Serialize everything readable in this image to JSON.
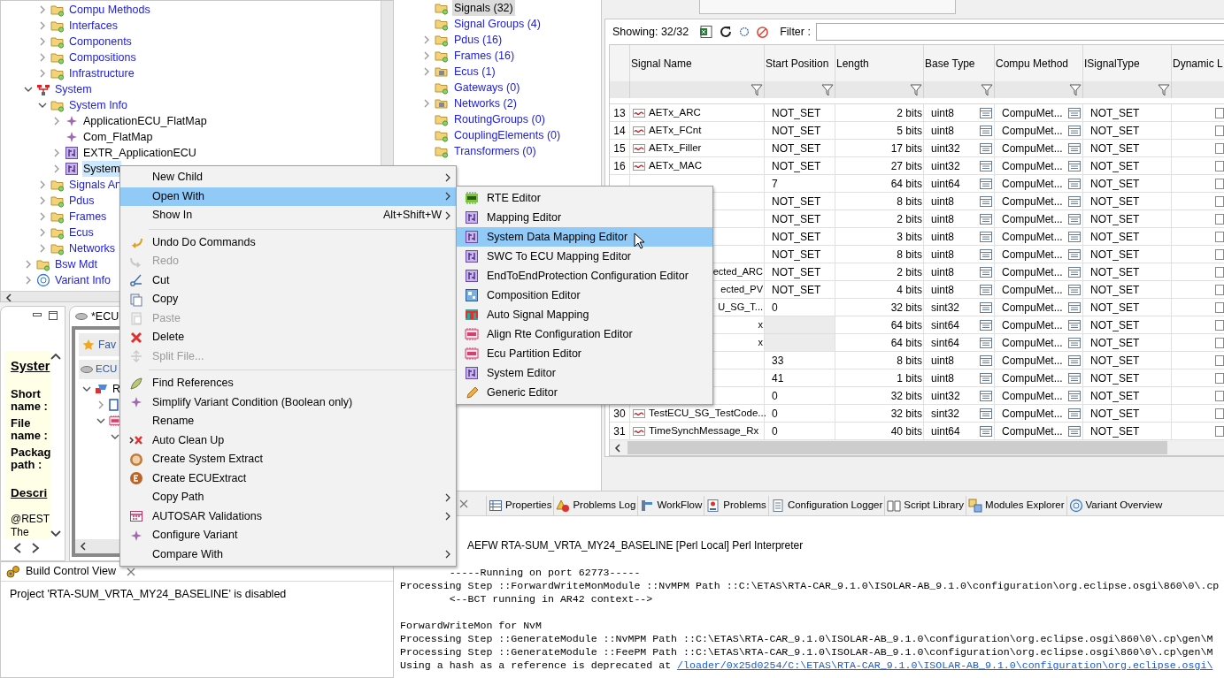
{
  "project_tree": {
    "items": [
      {
        "children": [
          {
            "label": "Compu Methods",
            "kind": "folder",
            "expanded": false
          },
          {
            "label": "Interfaces",
            "kind": "folder",
            "expanded": false
          },
          {
            "label": "Components",
            "kind": "folder",
            "expanded": false
          },
          {
            "label": "Compositions",
            "kind": "folder",
            "expanded": false
          },
          {
            "label": "Infrastructure",
            "kind": "folder",
            "expanded": false
          }
        ]
      },
      {
        "label": "System",
        "kind": "system",
        "expanded": true,
        "children": [
          {
            "label": "System Info",
            "kind": "folder",
            "expanded": true,
            "children": [
              {
                "label": "ApplicationECU_FlatMap",
                "kind": "diamond",
                "expanded": false
              },
              {
                "label": "Com_FlatMap",
                "kind": "diamond"
              },
              {
                "label": "EXTR_ApplicationECU",
                "kind": "component",
                "expanded": false
              },
              {
                "label": "System",
                "kind": "component",
                "expanded": false,
                "selected": true
              }
            ]
          },
          {
            "label": "Signals An",
            "kind": "folder",
            "expanded": false
          },
          {
            "label": "Pdus",
            "kind": "folder",
            "expanded": false
          },
          {
            "label": "Frames",
            "kind": "folder",
            "expanded": false
          },
          {
            "label": "Ecus",
            "kind": "folder",
            "expanded": false
          },
          {
            "label": "Networks",
            "kind": "folder",
            "expanded": false
          }
        ]
      },
      {
        "label": "Bsw Mdt",
        "kind": "folder",
        "expanded": false
      },
      {
        "label": "Variant Info",
        "kind": "variant",
        "expanded": false
      }
    ]
  },
  "element_tree": {
    "items": [
      {
        "label": "Signals (32)",
        "kind": "folder",
        "selected": true
      },
      {
        "label": "Signal Groups (4)",
        "kind": "folder",
        "selected": false
      },
      {
        "label": "Pdus (16)",
        "kind": "folder",
        "expanded": false,
        "selected": false
      },
      {
        "label": "Frames (16)",
        "kind": "folder",
        "expanded": false,
        "selected": false
      },
      {
        "label": "Ecus (1)",
        "kind": "chip_folder",
        "expanded": false,
        "selected": false
      },
      {
        "label": "Gateways (0)",
        "kind": "folder",
        "selected": false
      },
      {
        "label": "Networks (2)",
        "kind": "chip_folder",
        "expanded": false,
        "selected": false
      },
      {
        "label": "RoutingGroups (0)",
        "kind": "folder",
        "selected": false
      },
      {
        "label": "CouplingElements (0)",
        "kind": "folder",
        "selected": false
      },
      {
        "label": "Transformers (0)",
        "kind": "folder",
        "selected": false
      }
    ]
  },
  "signal_table": {
    "showing": "Showing: 32/32",
    "filter_label": "Filter :",
    "columns": [
      "Signal Name",
      "Start Position",
      "Length",
      "Base Type",
      "Compu Method",
      "ISignalType",
      "Dynamic L"
    ],
    "rows": [
      {
        "num": "13",
        "name": "AETx_ARC",
        "start": "NOT_SET",
        "length": "2 bits",
        "base_type": "uint8",
        "compu_method": "CompuMet...",
        "isignal_type": "NOT_SET",
        "dynamic_length": false
      },
      {
        "num": "14",
        "name": "AETx_FCnt",
        "start": "NOT_SET",
        "length": "5 bits",
        "base_type": "uint8",
        "compu_method": "CompuMet...",
        "isignal_type": "NOT_SET",
        "dynamic_length": false
      },
      {
        "num": "15",
        "name": "AETx_Filler",
        "start": "NOT_SET",
        "length": "17 bits",
        "base_type": "uint32",
        "compu_method": "CompuMet...",
        "isignal_type": "NOT_SET",
        "dynamic_length": false
      },
      {
        "num": "16",
        "name": "AETx_MAC",
        "start": "NOT_SET",
        "length": "27 bits",
        "base_type": "uint32",
        "compu_method": "CompuMet...",
        "isignal_type": "NOT_SET",
        "dynamic_length": false
      },
      {
        "start": "7",
        "length": "64 bits",
        "base_type": "uint64",
        "compu_method": "CompuMet...",
        "isignal_type": "NOT_SET",
        "dynamic_length": false
      },
      {
        "start": "NOT_SET",
        "length": "8 bits",
        "base_type": "uint8",
        "compu_method": "CompuMet...",
        "isignal_type": "NOT_SET",
        "dynamic_length": false
      },
      {
        "start": "NOT_SET",
        "length": "2 bits",
        "base_type": "uint8",
        "compu_method": "CompuMet...",
        "isignal_type": "NOT_SET",
        "dynamic_length": false
      },
      {
        "start": "NOT_SET",
        "length": "3 bits",
        "base_type": "uint8",
        "compu_method": "CompuMet...",
        "isignal_type": "NOT_SET",
        "dynamic_length": false
      },
      {
        "start": "NOT_SET",
        "length": "8 bits",
        "base_type": "uint8",
        "compu_method": "CompuMet...",
        "isignal_type": "NOT_SET",
        "dynamic_length": false
      },
      {
        "name": "ected_ARC",
        "start": "NOT_SET",
        "length": "2 bits",
        "base_type": "uint8",
        "compu_method": "CompuMet...",
        "isignal_type": "NOT_SET",
        "dynamic_length": false
      },
      {
        "name": "ected_PV",
        "start": "NOT_SET",
        "length": "4 bits",
        "base_type": "uint8",
        "compu_method": "CompuMet...",
        "isignal_type": "NOT_SET",
        "dynamic_length": false
      },
      {
        "name": "U_SG_T...",
        "start": "0",
        "length": "32 bits",
        "base_type": "sint32",
        "compu_method": "CompuMet...",
        "isignal_type": "NOT_SET",
        "dynamic_length": false
      },
      {
        "name": "x",
        "start_disabled": true,
        "length": "64 bits",
        "base_type": "sint64",
        "compu_method": "CompuMet...",
        "isignal_type": "NOT_SET",
        "dynamic_length": false
      },
      {
        "name": "x",
        "start_disabled": true,
        "length": "64 bits",
        "base_type": "sint64",
        "compu_method": "CompuMet...",
        "isignal_type": "NOT_SET",
        "dynamic_length": false
      },
      {
        "start": "33",
        "length": "8 bits",
        "base_type": "uint8",
        "compu_method": "CompuMet...",
        "isignal_type": "NOT_SET",
        "dynamic_length": false
      },
      {
        "start": "41",
        "length": "1 bits",
        "base_type": "uint8",
        "compu_method": "CompuMet...",
        "isignal_type": "NOT_SET",
        "dynamic_length": false
      },
      {
        "start": "0",
        "length": "32 bits",
        "base_type": "uint32",
        "compu_method": "CompuMet...",
        "isignal_type": "NOT_SET",
        "dynamic_length": false
      },
      {
        "num": "30",
        "name": "TestECU_SG_TestCode...",
        "start": "0",
        "length": "32 bits",
        "base_type": "sint32",
        "compu_method": "CompuMet...",
        "isignal_type": "NOT_SET",
        "dynamic_length": false
      },
      {
        "num": "31",
        "name": "TimeSynchMessage_Rx",
        "start": "0",
        "length": "40 bits",
        "base_type": "uint64",
        "compu_method": "CompuMet...",
        "isignal_type": "NOT_SET",
        "dynamic_length": false
      }
    ]
  },
  "description_panel": {
    "heading": "Syster",
    "fields": [
      "Short name :",
      "File name :",
      "Packag path :"
    ],
    "section": "Descri",
    "text_lines": [
      "@REST",
      "The"
    ]
  },
  "ecu_editor": {
    "tab": "*ECU",
    "favorites": "Fav",
    "ecu": "ECU",
    "node": "R"
  },
  "build_control": {
    "title": "Build Control View",
    "message": "Project 'RTA-SUM_VRTA_MY24_BASELINE' is disabled"
  },
  "bottom_tabs": [
    {
      "label": "Properties",
      "kind": "table"
    },
    {
      "label": "Problems Log",
      "kind": "warning"
    },
    {
      "label": "WorkFlow",
      "kind": "flow"
    },
    {
      "label": "Problems",
      "kind": "problems"
    },
    {
      "label": "Configuration Logger",
      "kind": "log"
    },
    {
      "label": "Script Library",
      "kind": "book"
    },
    {
      "label": "Modules Explorer",
      "kind": "modules"
    },
    {
      "label": "Variant Overview",
      "kind": "variant"
    }
  ],
  "console": {
    "title": "AEFW RTA-SUM_VRTA_MY24_BASELINE [Perl Local] Perl Interpreter",
    "lines": [
      {
        "text": "        -----Running on port 62773-----"
      },
      {
        "text": "Processing Step ::ForwardWriteMonModule ::NvMPM Path ::C:\\ETAS\\RTA-CAR_9.1.0\\ISOLAR-AB_9.1.0\\configuration\\org.eclipse.osgi\\860\\0\\.cp"
      },
      {
        "text": "        <--BCT running in AR42 context-->"
      },
      {
        "text": "ForwardWriteMon for NvM",
        "gap_before": true
      },
      {
        "text": "Processing Step ::GenerateModule ::NvMPM Path ::C:\\ETAS\\RTA-CAR_9.1.0\\ISOLAR-AB_9.1.0\\configuration\\org.eclipse.osgi\\860\\0\\.cp\\gen\\M"
      },
      {
        "text": "Processing Step ::GenerateModule ::FeePM Path ::C:\\ETAS\\RTA-CAR_9.1.0\\ISOLAR-AB_9.1.0\\configuration\\org.eclipse.osgi\\860\\0\\.cp\\gen\\M"
      },
      {
        "text": "Using a hash as a reference is deprecated at ",
        "link": "/loader/0x25d0254/C:\\ETAS\\RTA-CAR_9.1.0\\ISOLAR-AB_9.1.0\\configuration\\org.eclipse.osgi\\"
      }
    ]
  },
  "context_menu": {
    "items": [
      {
        "label": "New Child",
        "submenu": true
      },
      {
        "label": "Open With",
        "submenu": true,
        "selected": true
      },
      {
        "label": "Show In",
        "shortcut": "Alt+Shift+W",
        "submenu": true
      },
      {
        "label": "Undo Do Commands",
        "kind": "undo",
        "separator_before": true
      },
      {
        "label": "Redo",
        "kind": "redo",
        "disabled": true
      },
      {
        "label": "Cut",
        "kind": "cut"
      },
      {
        "label": "Copy",
        "kind": "copy"
      },
      {
        "label": "Paste",
        "kind": "paste",
        "disabled": true
      },
      {
        "label": "Delete",
        "kind": "delete"
      },
      {
        "label": "Split File...",
        "kind": "split",
        "disabled": true
      },
      {
        "label": "Find References",
        "kind": "find",
        "separator_before": true
      },
      {
        "label": "Simplify Variant Condition (Boolean only)",
        "kind": "diamond"
      },
      {
        "label": "Rename"
      },
      {
        "label": "Auto Clean Up",
        "kind": "clean"
      },
      {
        "label": "Create System Extract",
        "kind": "s_badge"
      },
      {
        "label": "Create ECUExtract",
        "kind": "e_badge"
      },
      {
        "label": "Copy Path",
        "submenu": true
      },
      {
        "label": "AUTOSAR Validations",
        "kind": "validation",
        "submenu": true
      },
      {
        "label": "Configure Variant",
        "kind": "diamond"
      },
      {
        "label": "Compare With",
        "submenu": true
      }
    ]
  },
  "open_with_menu": {
    "items": [
      {
        "label": "RTE Editor",
        "kind": "rte",
        "selected": false
      },
      {
        "label": "Mapping Editor",
        "kind": "component",
        "selected": false
      },
      {
        "label": "System Data Mapping Editor",
        "kind": "component",
        "selected": true
      },
      {
        "label": "SWC To ECU Mapping Editor",
        "kind": "component",
        "selected": false
      },
      {
        "label": "EndToEndProtection Configuration Editor",
        "kind": "component",
        "selected": false
      },
      {
        "label": "Composition Editor",
        "kind": "composition",
        "selected": false
      },
      {
        "label": "Auto Signal Mapping",
        "kind": "autosignal",
        "selected": false
      },
      {
        "label": "Align Rte Configuration Editor",
        "kind": "ecu_pink",
        "selected": false
      },
      {
        "label": "Ecu Partition Editor",
        "kind": "ecu_pink",
        "selected": false
      },
      {
        "label": "System Editor",
        "kind": "component",
        "selected": false
      },
      {
        "label": "Generic Editor",
        "kind": "pencil",
        "selected": false
      }
    ]
  }
}
